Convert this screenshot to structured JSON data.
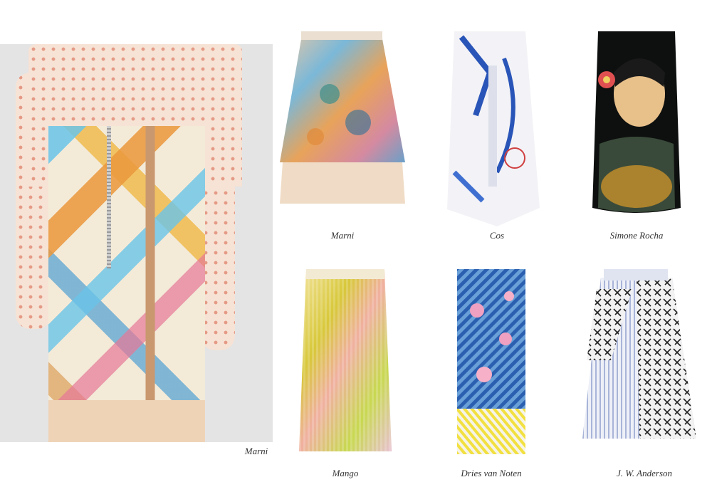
{
  "hero": {
    "caption": "Marni"
  },
  "grid": [
    {
      "caption": "Marni"
    },
    {
      "caption": "Cos"
    },
    {
      "caption": "Simone Rocha"
    },
    {
      "caption": "Mango"
    },
    {
      "caption": "Dries van Noten"
    },
    {
      "caption": "J. W. Anderson"
    }
  ]
}
